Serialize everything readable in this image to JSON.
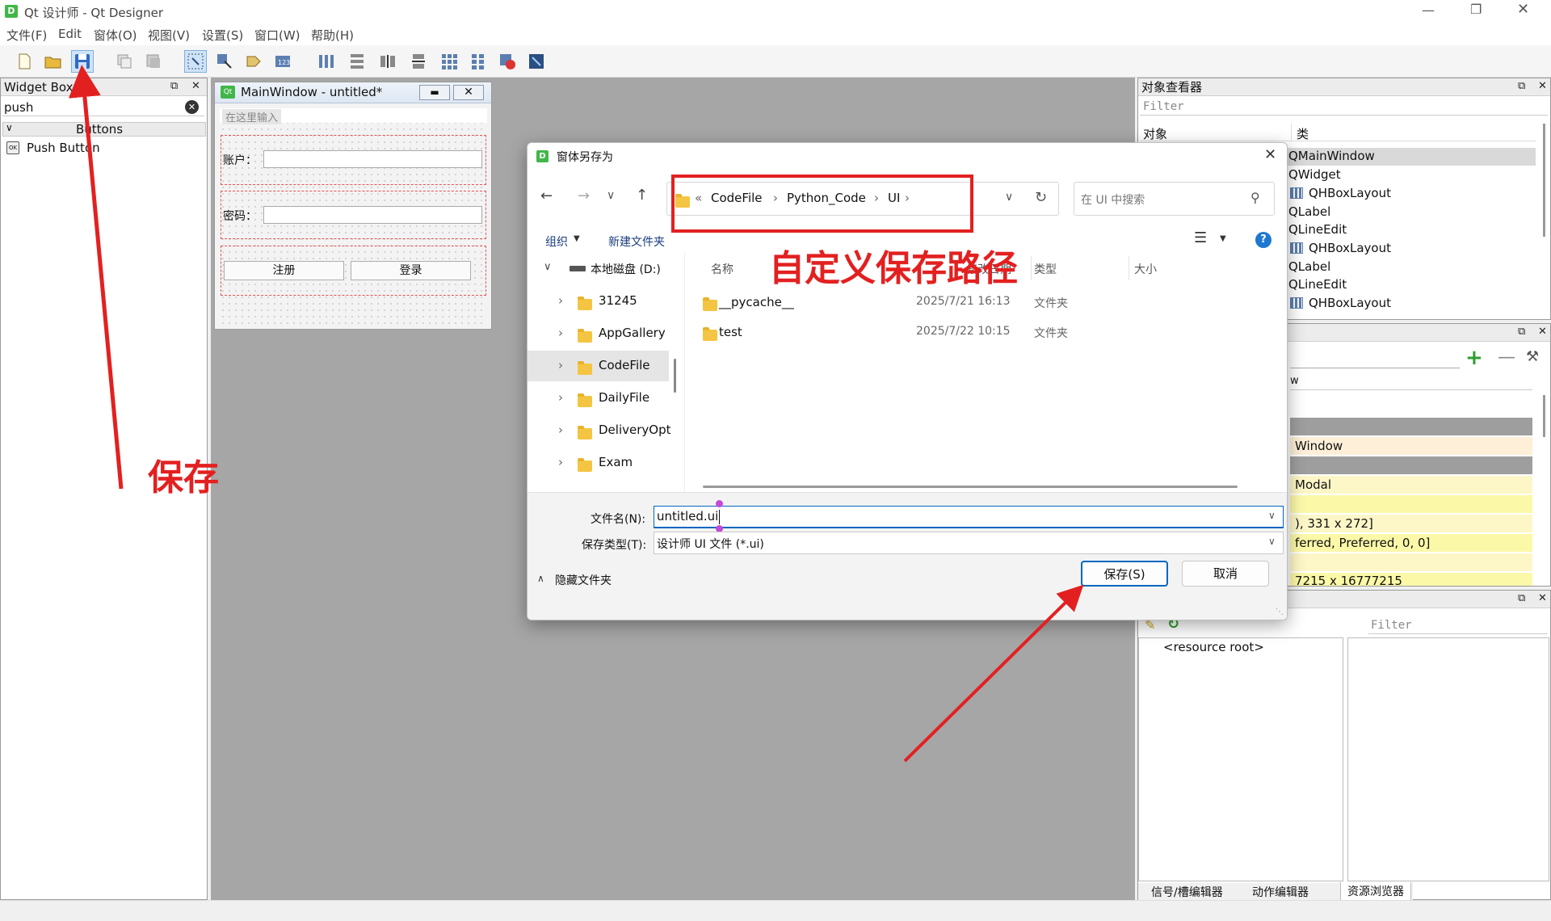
{
  "window": {
    "title": "Qt 设计师 - Qt Designer"
  },
  "menubar": [
    "文件(F)",
    "Edit",
    "窗体(O)",
    "视图(V)",
    "设置(S)",
    "窗口(W)",
    "帮助(H)"
  ],
  "widget_box": {
    "title": "Widget Box",
    "search_value": "push",
    "category": "Buttons",
    "items": [
      "Push Button"
    ]
  },
  "form": {
    "title": "MainWindow - untitled*",
    "menu_placeholder": "在这里输入",
    "account_label": "账户：",
    "password_label": "密码：",
    "register_label": "注册",
    "login_label": "登录"
  },
  "object_inspector": {
    "title": "对象查看器",
    "filter_placeholder": "Filter",
    "col_object": "对象",
    "col_class": "类",
    "classes": [
      "QMainWindow",
      "QWidget",
      "QHBoxLayout",
      "QLabel",
      "QLineEdit",
      "QHBoxLayout",
      "QLabel",
      "QLineEdit",
      "QHBoxLayout"
    ]
  },
  "property_editor": {
    "header_fragment": "w",
    "rows": [
      "Window",
      "",
      "Modal",
      "",
      "), 331 x 272]",
      "ferred, Preferred, 0, 0]",
      "",
      "7215 x 16777215"
    ]
  },
  "resource_browser": {
    "filter_placeholder": "Filter",
    "root": "<resource root>",
    "tabs": [
      "信号/槽编辑器",
      "动作编辑器",
      "资源浏览器"
    ]
  },
  "dialog": {
    "title": "窗体另存为",
    "breadcrumb": [
      "CodeFile",
      "Python_Code",
      "UI"
    ],
    "search_placeholder": "在 UI 中搜索",
    "organize_label": "组织",
    "new_folder_label": "新建文件夹",
    "nav": {
      "drive": "本地磁盘 (D:)",
      "folders": [
        "31245",
        "AppGallery",
        "CodeFile",
        "DailyFile",
        "DeliveryOpt",
        "Exam"
      ],
      "selected": "CodeFile"
    },
    "columns": {
      "name": "名称",
      "date": "修改日期",
      "type": "类型",
      "size": "大小"
    },
    "files": [
      {
        "name": "__pycache__",
        "date": "2025/7/21 16:13",
        "type": "文件夹"
      },
      {
        "name": "test",
        "date": "2025/7/22 10:15",
        "type": "文件夹"
      }
    ],
    "filename_label": "文件名(N):",
    "filename_value": "untitled.ui",
    "filetype_label": "保存类型(T):",
    "filetype_value": "设计师 UI 文件 (*.ui)",
    "hide_folders_label": "隐藏文件夹",
    "save_label": "保存(S)",
    "cancel_label": "取消"
  },
  "annotations": {
    "save": "保存",
    "custom_path": "自定义保存路径"
  },
  "colors": {
    "annotation": "#e32020",
    "accent": "#0067c0"
  }
}
